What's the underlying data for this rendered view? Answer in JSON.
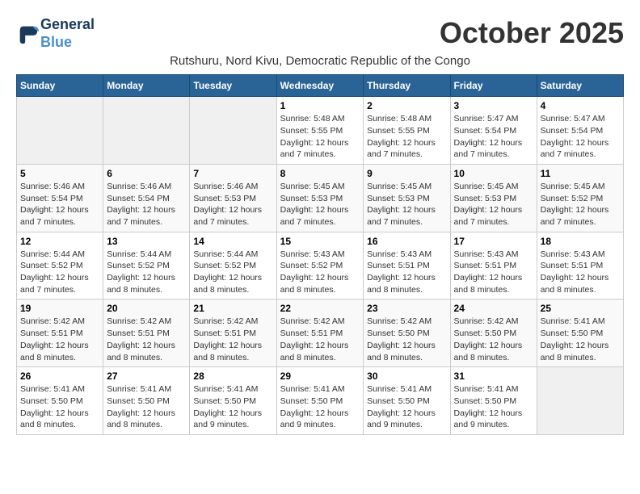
{
  "logo": {
    "line1": "General",
    "line2": "Blue"
  },
  "title": "October 2025",
  "subtitle": "Rutshuru, Nord Kivu, Democratic Republic of the Congo",
  "headers": [
    "Sunday",
    "Monday",
    "Tuesday",
    "Wednesday",
    "Thursday",
    "Friday",
    "Saturday"
  ],
  "weeks": [
    [
      {
        "day": "",
        "sunrise": "",
        "sunset": "",
        "daylight": ""
      },
      {
        "day": "",
        "sunrise": "",
        "sunset": "",
        "daylight": ""
      },
      {
        "day": "",
        "sunrise": "",
        "sunset": "",
        "daylight": ""
      },
      {
        "day": "1",
        "sunrise": "Sunrise: 5:48 AM",
        "sunset": "Sunset: 5:55 PM",
        "daylight": "Daylight: 12 hours and 7 minutes."
      },
      {
        "day": "2",
        "sunrise": "Sunrise: 5:48 AM",
        "sunset": "Sunset: 5:55 PM",
        "daylight": "Daylight: 12 hours and 7 minutes."
      },
      {
        "day": "3",
        "sunrise": "Sunrise: 5:47 AM",
        "sunset": "Sunset: 5:54 PM",
        "daylight": "Daylight: 12 hours and 7 minutes."
      },
      {
        "day": "4",
        "sunrise": "Sunrise: 5:47 AM",
        "sunset": "Sunset: 5:54 PM",
        "daylight": "Daylight: 12 hours and 7 minutes."
      }
    ],
    [
      {
        "day": "5",
        "sunrise": "Sunrise: 5:46 AM",
        "sunset": "Sunset: 5:54 PM",
        "daylight": "Daylight: 12 hours and 7 minutes."
      },
      {
        "day": "6",
        "sunrise": "Sunrise: 5:46 AM",
        "sunset": "Sunset: 5:54 PM",
        "daylight": "Daylight: 12 hours and 7 minutes."
      },
      {
        "day": "7",
        "sunrise": "Sunrise: 5:46 AM",
        "sunset": "Sunset: 5:53 PM",
        "daylight": "Daylight: 12 hours and 7 minutes."
      },
      {
        "day": "8",
        "sunrise": "Sunrise: 5:45 AM",
        "sunset": "Sunset: 5:53 PM",
        "daylight": "Daylight: 12 hours and 7 minutes."
      },
      {
        "day": "9",
        "sunrise": "Sunrise: 5:45 AM",
        "sunset": "Sunset: 5:53 PM",
        "daylight": "Daylight: 12 hours and 7 minutes."
      },
      {
        "day": "10",
        "sunrise": "Sunrise: 5:45 AM",
        "sunset": "Sunset: 5:53 PM",
        "daylight": "Daylight: 12 hours and 7 minutes."
      },
      {
        "day": "11",
        "sunrise": "Sunrise: 5:45 AM",
        "sunset": "Sunset: 5:52 PM",
        "daylight": "Daylight: 12 hours and 7 minutes."
      }
    ],
    [
      {
        "day": "12",
        "sunrise": "Sunrise: 5:44 AM",
        "sunset": "Sunset: 5:52 PM",
        "daylight": "Daylight: 12 hours and 7 minutes."
      },
      {
        "day": "13",
        "sunrise": "Sunrise: 5:44 AM",
        "sunset": "Sunset: 5:52 PM",
        "daylight": "Daylight: 12 hours and 8 minutes."
      },
      {
        "day": "14",
        "sunrise": "Sunrise: 5:44 AM",
        "sunset": "Sunset: 5:52 PM",
        "daylight": "Daylight: 12 hours and 8 minutes."
      },
      {
        "day": "15",
        "sunrise": "Sunrise: 5:43 AM",
        "sunset": "Sunset: 5:52 PM",
        "daylight": "Daylight: 12 hours and 8 minutes."
      },
      {
        "day": "16",
        "sunrise": "Sunrise: 5:43 AM",
        "sunset": "Sunset: 5:51 PM",
        "daylight": "Daylight: 12 hours and 8 minutes."
      },
      {
        "day": "17",
        "sunrise": "Sunrise: 5:43 AM",
        "sunset": "Sunset: 5:51 PM",
        "daylight": "Daylight: 12 hours and 8 minutes."
      },
      {
        "day": "18",
        "sunrise": "Sunrise: 5:43 AM",
        "sunset": "Sunset: 5:51 PM",
        "daylight": "Daylight: 12 hours and 8 minutes."
      }
    ],
    [
      {
        "day": "19",
        "sunrise": "Sunrise: 5:42 AM",
        "sunset": "Sunset: 5:51 PM",
        "daylight": "Daylight: 12 hours and 8 minutes."
      },
      {
        "day": "20",
        "sunrise": "Sunrise: 5:42 AM",
        "sunset": "Sunset: 5:51 PM",
        "daylight": "Daylight: 12 hours and 8 minutes."
      },
      {
        "day": "21",
        "sunrise": "Sunrise: 5:42 AM",
        "sunset": "Sunset: 5:51 PM",
        "daylight": "Daylight: 12 hours and 8 minutes."
      },
      {
        "day": "22",
        "sunrise": "Sunrise: 5:42 AM",
        "sunset": "Sunset: 5:51 PM",
        "daylight": "Daylight: 12 hours and 8 minutes."
      },
      {
        "day": "23",
        "sunrise": "Sunrise: 5:42 AM",
        "sunset": "Sunset: 5:50 PM",
        "daylight": "Daylight: 12 hours and 8 minutes."
      },
      {
        "day": "24",
        "sunrise": "Sunrise: 5:42 AM",
        "sunset": "Sunset: 5:50 PM",
        "daylight": "Daylight: 12 hours and 8 minutes."
      },
      {
        "day": "25",
        "sunrise": "Sunrise: 5:41 AM",
        "sunset": "Sunset: 5:50 PM",
        "daylight": "Daylight: 12 hours and 8 minutes."
      }
    ],
    [
      {
        "day": "26",
        "sunrise": "Sunrise: 5:41 AM",
        "sunset": "Sunset: 5:50 PM",
        "daylight": "Daylight: 12 hours and 8 minutes."
      },
      {
        "day": "27",
        "sunrise": "Sunrise: 5:41 AM",
        "sunset": "Sunset: 5:50 PM",
        "daylight": "Daylight: 12 hours and 8 minutes."
      },
      {
        "day": "28",
        "sunrise": "Sunrise: 5:41 AM",
        "sunset": "Sunset: 5:50 PM",
        "daylight": "Daylight: 12 hours and 9 minutes."
      },
      {
        "day": "29",
        "sunrise": "Sunrise: 5:41 AM",
        "sunset": "Sunset: 5:50 PM",
        "daylight": "Daylight: 12 hours and 9 minutes."
      },
      {
        "day": "30",
        "sunrise": "Sunrise: 5:41 AM",
        "sunset": "Sunset: 5:50 PM",
        "daylight": "Daylight: 12 hours and 9 minutes."
      },
      {
        "day": "31",
        "sunrise": "Sunrise: 5:41 AM",
        "sunset": "Sunset: 5:50 PM",
        "daylight": "Daylight: 12 hours and 9 minutes."
      },
      {
        "day": "",
        "sunrise": "",
        "sunset": "",
        "daylight": ""
      }
    ]
  ]
}
